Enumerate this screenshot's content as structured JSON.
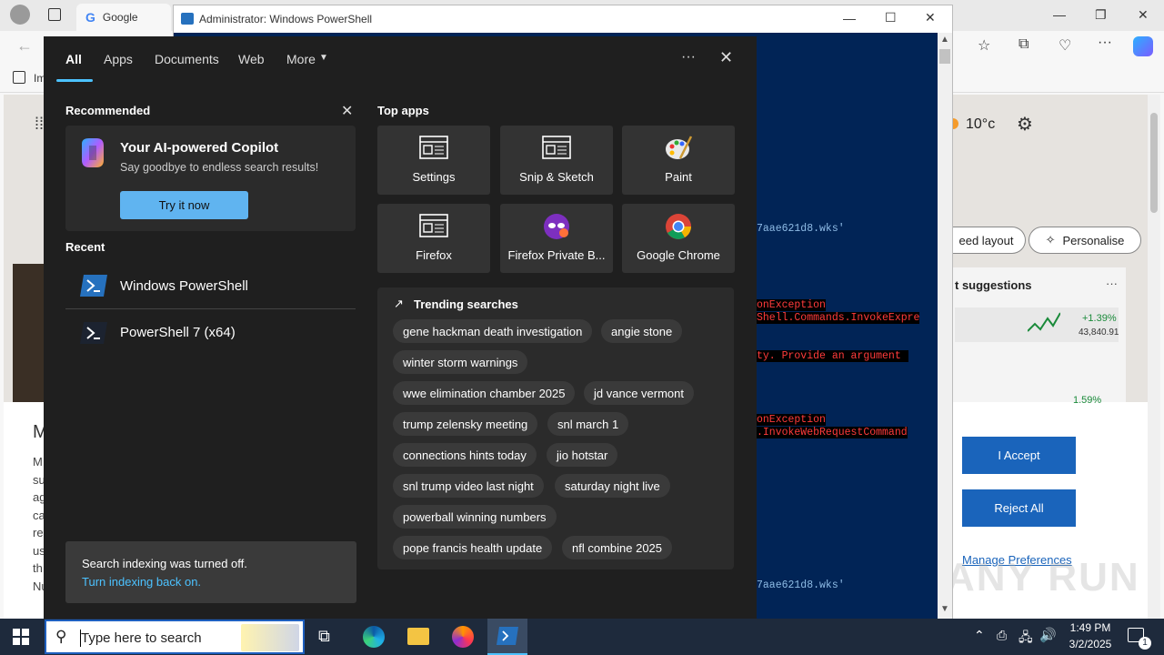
{
  "browser": {
    "tab_title": "Google",
    "fav_partial": "Im",
    "weather_temp": "10°c",
    "feed_layout": "eed layout",
    "personalise": "Personalise",
    "suggestions": "t suggestions",
    "stock_change": "+1.39%",
    "stock_value": "43,840.91",
    "stock_change_2": "1.59%",
    "side_letter": "M",
    "cookie_accept": "I Accept",
    "cookie_reject": "Reject All",
    "cookie_manage": "Manage Preferences",
    "left_text_letters": [
      "M",
      "su",
      "ag",
      "ca",
      "re",
      "us",
      "th",
      "Nu"
    ]
  },
  "powershell": {
    "title": "Administrator: Windows PowerShell",
    "lines": [
      {
        "text": "7aae621d8.wks'",
        "color": "#8fbce6"
      },
      {
        "text": "onException",
        "color": "#ff3b3b"
      },
      {
        "text": "Shell.Commands.InvokeExpre",
        "color": "#ff3b3b"
      },
      {
        "text": "ty. Provide an argument",
        "color": "#ff3b3b"
      },
      {
        "text": "onException",
        "color": "#ff3b3b"
      },
      {
        "text": ".InvokeWebRequestCommand",
        "color": "#ff3b3b"
      },
      {
        "text": "7aae621d8.wks'",
        "color": "#8fbce6"
      }
    ]
  },
  "search": {
    "tabs": [
      "All",
      "Apps",
      "Documents",
      "Web",
      "More"
    ],
    "recommended_heading": "Recommended",
    "copilot_title": "Your AI-powered Copilot",
    "copilot_sub": "Say goodbye to endless search results!",
    "copilot_btn": "Try it now",
    "recent_heading": "Recent",
    "recent": [
      "Windows PowerShell",
      "PowerShell 7 (x64)"
    ],
    "top_apps_heading": "Top apps",
    "top_apps": [
      "Settings",
      "Snip & Sketch",
      "Paint",
      "Firefox",
      "Firefox Private B...",
      "Google Chrome"
    ],
    "trending_heading": "Trending searches",
    "trending": [
      "gene hackman death investigation",
      "angie stone",
      "winter storm warnings",
      "wwe elimination chamber 2025",
      "jd vance vermont",
      "trump zelensky meeting",
      "snl march 1",
      "connections hints today",
      "jio hotstar",
      "snl trump video last night",
      "saturday night live",
      "powerball winning numbers",
      "pope francis health update",
      "nfl combine 2025"
    ],
    "indexing_text": "Search indexing was turned off.",
    "indexing_link": "Turn indexing back on."
  },
  "taskbar": {
    "search_placeholder": "Type here to search",
    "time": "1:49 PM",
    "date": "3/2/2025",
    "notification_count": "1"
  },
  "watermark": "ANY RUN",
  "colors": {
    "accent": "#4cc2ff",
    "panel_bg": "#1f1f1f",
    "ps_bg": "#012456",
    "copilot_btn": "#60b4f0"
  }
}
